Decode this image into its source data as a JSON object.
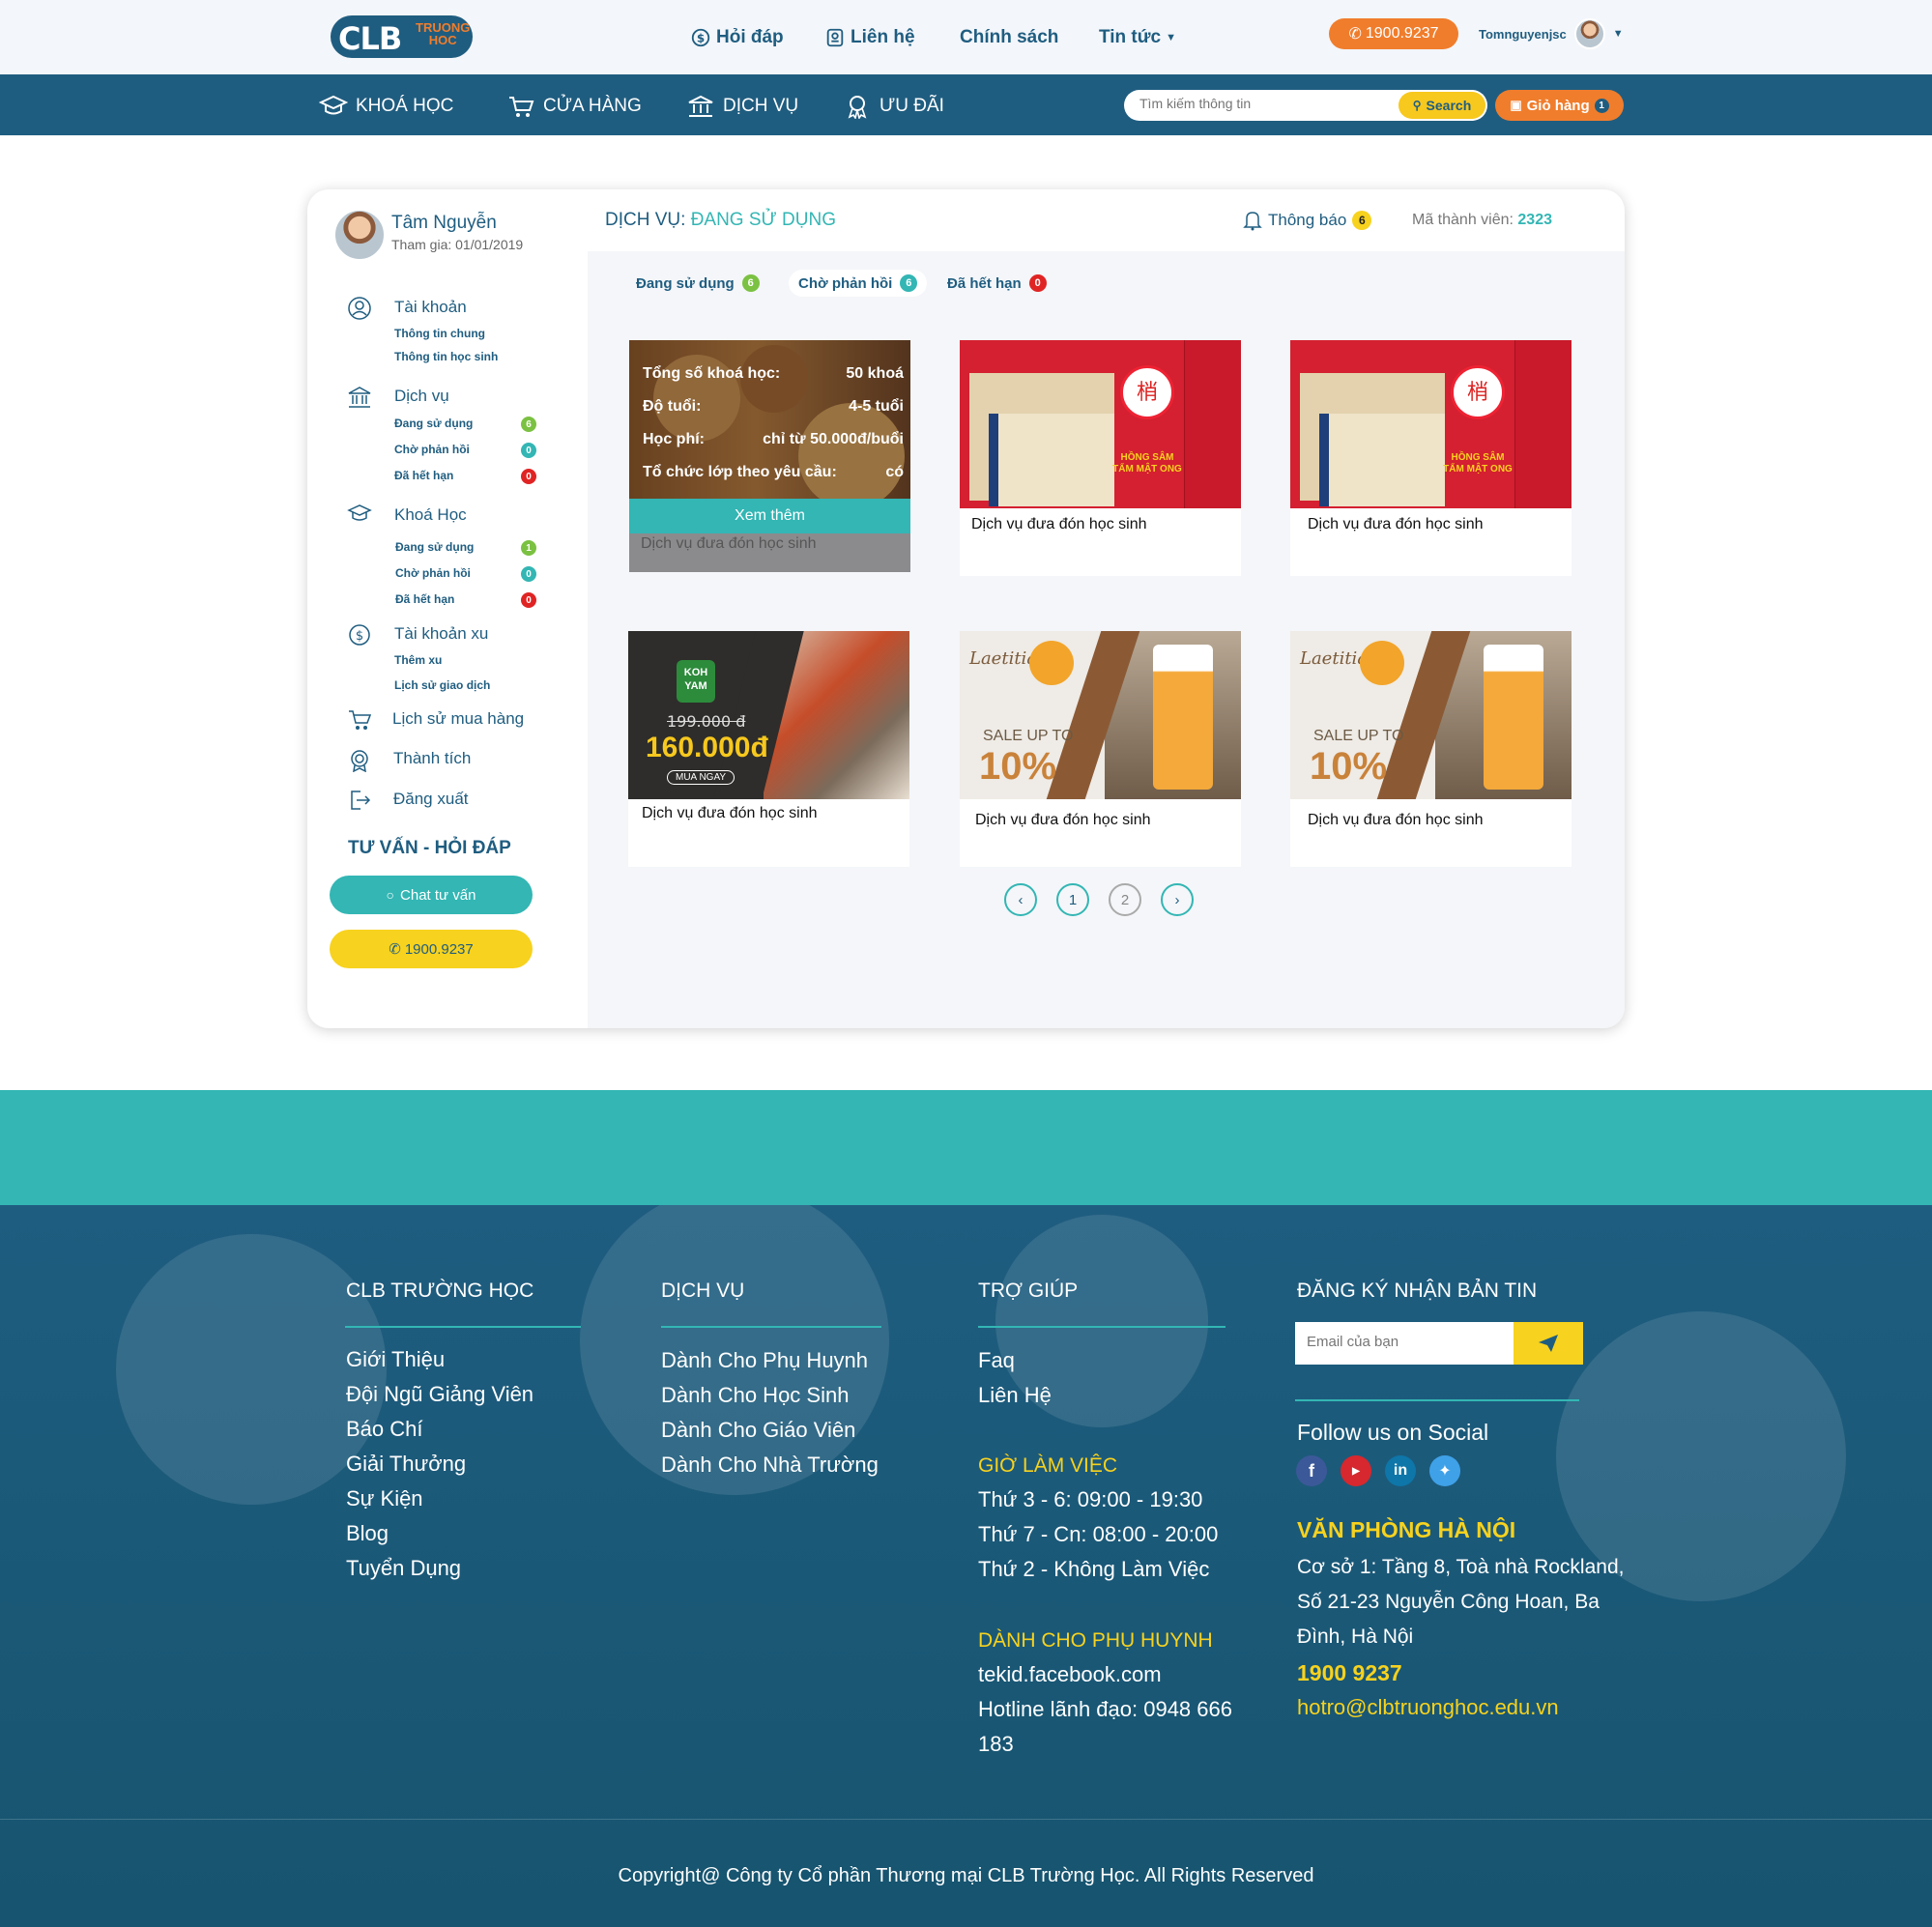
{
  "header": {
    "logo_big": "CLB",
    "logo_small_1": "TRUONG",
    "logo_small_2": "HOC",
    "nav": [
      "Hỏi đáp",
      "Liên hệ",
      "Chính sách",
      "Tin tức"
    ],
    "phone": "1900.9237",
    "username": "Tomnguyenjsc"
  },
  "navbar": {
    "items": [
      "KHOÁ HỌC",
      "CỬA HÀNG",
      "DỊCH VỤ",
      "ƯU ĐÃI"
    ],
    "search_placeholder": "Tìm kiếm thông tin",
    "search_label": "Search",
    "cart_label": "Giỏ hàng",
    "cart_count": "1"
  },
  "sidebar": {
    "name": "Tâm Nguyễn",
    "joined": "Tham gia: 01/01/2019",
    "account": {
      "title": "Tài khoản",
      "items": [
        "Thông tin chung",
        "Thông tin học sinh"
      ]
    },
    "services": {
      "title": "Dịch vụ",
      "items": [
        {
          "label": "Đang sử dụng",
          "count": "6"
        },
        {
          "label": "Chờ phản hồi",
          "count": "0"
        },
        {
          "label": "Đã hết hạn",
          "count": "0"
        }
      ]
    },
    "courses": {
      "title": "Khoá Học",
      "items": [
        {
          "label": "Đang sử dụng",
          "count": "1"
        },
        {
          "label": "Chờ phản hồi",
          "count": "0"
        },
        {
          "label": "Đã hết hạn",
          "count": "0"
        }
      ]
    },
    "coins": {
      "title": "Tài khoản xu",
      "items": [
        "Thêm xu",
        "Lịch sử giao dịch"
      ]
    },
    "purchase_history": "Lịch sử mua hàng",
    "achievements": "Thành tích",
    "logout": "Đăng xuất",
    "faq_title": "TƯ VẤN - HỎI ĐÁP",
    "chat_label": "Chat tư vấn",
    "phone": "1900.9237"
  },
  "main": {
    "title_prefix": "DỊCH VỤ:",
    "title_highlight": "ĐANG SỬ DỤNG",
    "notif_label": "Thông báo",
    "notif_count": "6",
    "member_label": "Mã thành viên:",
    "member_id": "2323",
    "tabs": [
      {
        "label": "Đang sử dụng",
        "count": "6"
      },
      {
        "label": "Chờ phản hồi",
        "count": "6"
      },
      {
        "label": "Đã hết hạn",
        "count": "0"
      }
    ],
    "overlay": {
      "rows": [
        {
          "label": "Tổng số khoá học:",
          "value": "50 khoá"
        },
        {
          "label": "Độ tuổi:",
          "value": "4-5 tuổi"
        },
        {
          "label": "Học phí:",
          "value": "chỉ từ 50.000đ/buổi"
        },
        {
          "label": "Tổ chức lớp theo yêu cầu:",
          "value": "có"
        }
      ],
      "more": "Xem thêm"
    },
    "products": [
      {
        "caption": "Dịch vụ đưa đón học sinh"
      },
      {
        "caption": "Dịch vụ đưa đón học sinh",
        "img_text": "HỒNG SÂM TẨM MẬT ONG"
      },
      {
        "caption": "Dịch vụ đưa đón học sinh",
        "img_text": "HỒNG SÂM TẨM MẬT ONG"
      },
      {
        "caption": "Dịch vụ đưa đón học sinh",
        "old_price": "199.000 đ",
        "new_price": "160.000đ",
        "brand": "KOH YAM",
        "cta": "MUA NGAY"
      },
      {
        "caption": "Dịch vụ đưa đón học sinh",
        "brand": "Laetitia",
        "sale": "SALE UP TO",
        "percent": "10%"
      },
      {
        "caption": "Dịch vụ đưa đón học sinh",
        "brand": "Laetitia",
        "sale": "SALE UP TO",
        "percent": "10%"
      }
    ],
    "pages": [
      "1",
      "2"
    ]
  },
  "footer": {
    "col1": {
      "title": "CLB TRƯỜNG HỌC",
      "links": [
        "Giới Thiệu",
        "Đội Ngũ Giảng Viên",
        "Báo Chí",
        "Giải Thưởng",
        "Sự Kiện",
        "Blog",
        "Tuyển Dụng"
      ]
    },
    "col2": {
      "title": "DỊCH VỤ",
      "links": [
        "Dành Cho Phụ Huynh",
        "Dành Cho Học Sinh",
        "Dành Cho Giáo Viên",
        "Dành Cho Nhà Trường"
      ]
    },
    "col3": {
      "title": "TRỢ GIÚP",
      "links": [
        "Faq",
        "Liên Hệ"
      ],
      "hours_title": "GIỜ LÀM VIỆC",
      "hours": [
        "Thứ 3 - 6: 09:00 - 19:30",
        "Thứ 7 - Cn: 08:00 - 20:00",
        "Thứ 2 - Không Làm Việc"
      ],
      "parents_title": "DÀNH CHO PHỤ HUYNH",
      "parents": [
        "tekid.facebook.com",
        "Hotline lãnh đạo: 0948 666",
        "183"
      ]
    },
    "col4": {
      "title": "ĐĂNG KÝ NHẬN BẢN TIN",
      "email_placeholder": "Email của bạn",
      "social_title": "Follow us on Social",
      "office_title": "VĂN PHÒNG HÀ NỘI",
      "address": [
        "Cơ sở 1: Tầng 8, Toà nhà Rockland,",
        "Số 21-23 Nguyễn Công Hoan, Ba",
        "Đình, Hà Nội"
      ],
      "phone": "1900 9237",
      "email": "hotro@clbtruonghoc.edu.vn"
    },
    "copyright": "Copyright@ Công ty Cổ phần Thương mại CLB Trường Học. All Rights Reserved"
  },
  "colors": {
    "primary": "#1f5d80",
    "teal": "#33b6b4",
    "orange": "#f07d2c",
    "yellow": "#f7d21e"
  }
}
